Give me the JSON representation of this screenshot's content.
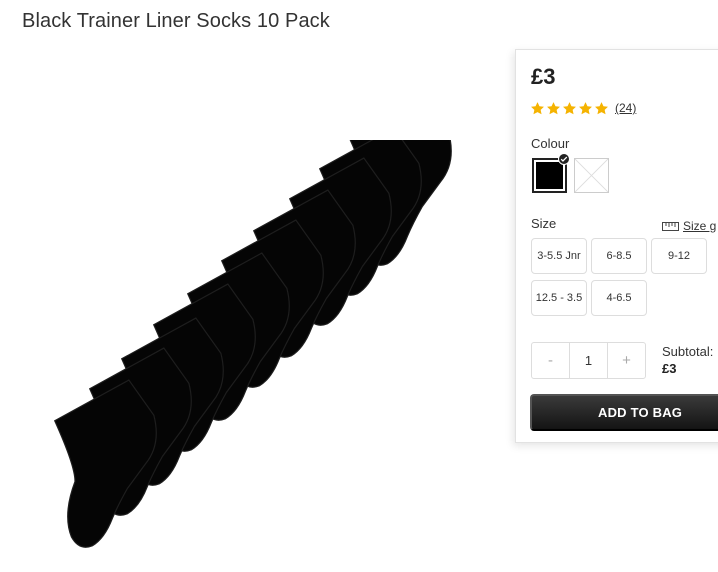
{
  "product": {
    "title": "Black Trainer Liner Socks 10 Pack",
    "image_name": "black-socks-product-image"
  },
  "purchase": {
    "price": "£3",
    "rating": {
      "stars": 5,
      "review_count": "(24)"
    },
    "colour_label": "Colour",
    "colours": [
      {
        "name": "black",
        "hex": "#000000",
        "selected": true
      },
      {
        "name": "white",
        "hex": "#ffffff",
        "selected": false
      }
    ],
    "size_label": "Size",
    "size_guide_label": "Size g",
    "sizes": [
      "3-5.5 Jnr",
      "6-8.5",
      "9-12",
      "12.5 - 3.5",
      "4-6.5"
    ],
    "quantity": {
      "minus": "-",
      "value": "1",
      "plus": "+"
    },
    "subtotal_label": "Subtotal:",
    "subtotal_value": "£3",
    "add_to_bag_label": "ADD TO BAG"
  },
  "colors": {
    "star": "#f5b301",
    "button_dark": "#1f1f1f",
    "border": "#dddddd"
  }
}
